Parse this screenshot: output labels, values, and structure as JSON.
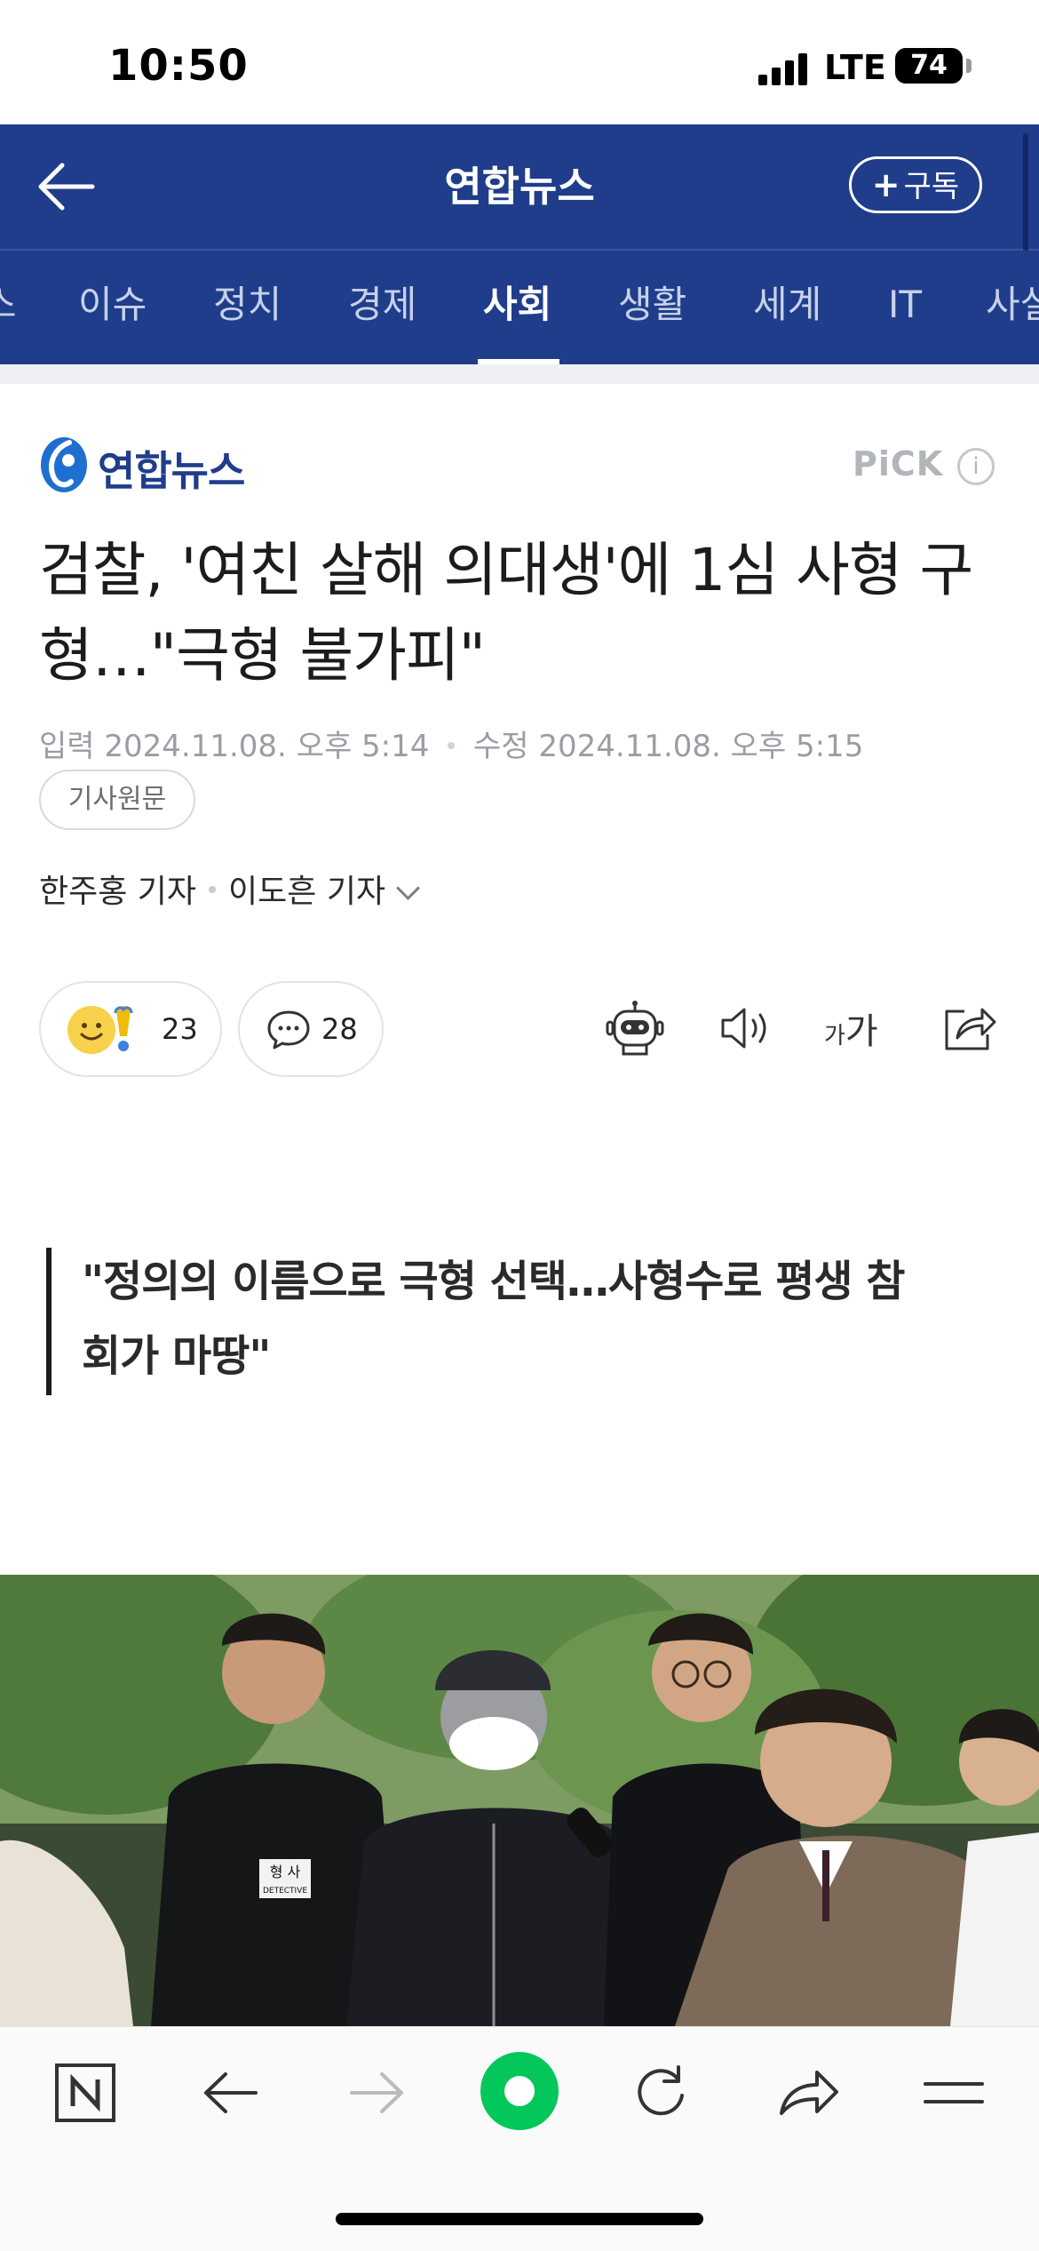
{
  "status_bar": {
    "time": "10:50",
    "network": "LTE",
    "battery": "74"
  },
  "header": {
    "title": "연합뉴스",
    "subscribe_label": "구독"
  },
  "tabs": [
    {
      "label": "스"
    },
    {
      "label": "이슈"
    },
    {
      "label": "정치"
    },
    {
      "label": "경제"
    },
    {
      "label": "사회",
      "active": true
    },
    {
      "label": "생활"
    },
    {
      "label": "세계"
    },
    {
      "label": "IT"
    },
    {
      "label": "사설"
    }
  ],
  "article": {
    "press_name": "연합뉴스",
    "pick_label": "PiCK",
    "pick_info": "i",
    "headline": "검찰, '여친 살해 의대생'에 1심 사형 구형…\"극형 불가피\"",
    "input_label": "입력",
    "input_date": "2024.11.08. 오후 5:14",
    "edit_label": "수정",
    "edit_date": "2024.11.08. 오후 5:15",
    "original_button": "기사원문",
    "reporter_1": "한주홍 기자",
    "reporter_2": "이도흔 기자",
    "reaction_count": "23",
    "comment_count": "28",
    "font_size_small": "가",
    "font_size_large": "가",
    "quote": "\"정의의 이름으로 극형 선택…사형수로 평생 참회가 마땅\""
  },
  "photo": {
    "vest_text": "형 사",
    "vest_subtext": "DETECTIVE"
  },
  "colors": {
    "brand": "#1f3d8a",
    "active_tab": "#ffffff",
    "inactive_tab": "#c7d1ea",
    "green_button": "#03c75a"
  }
}
